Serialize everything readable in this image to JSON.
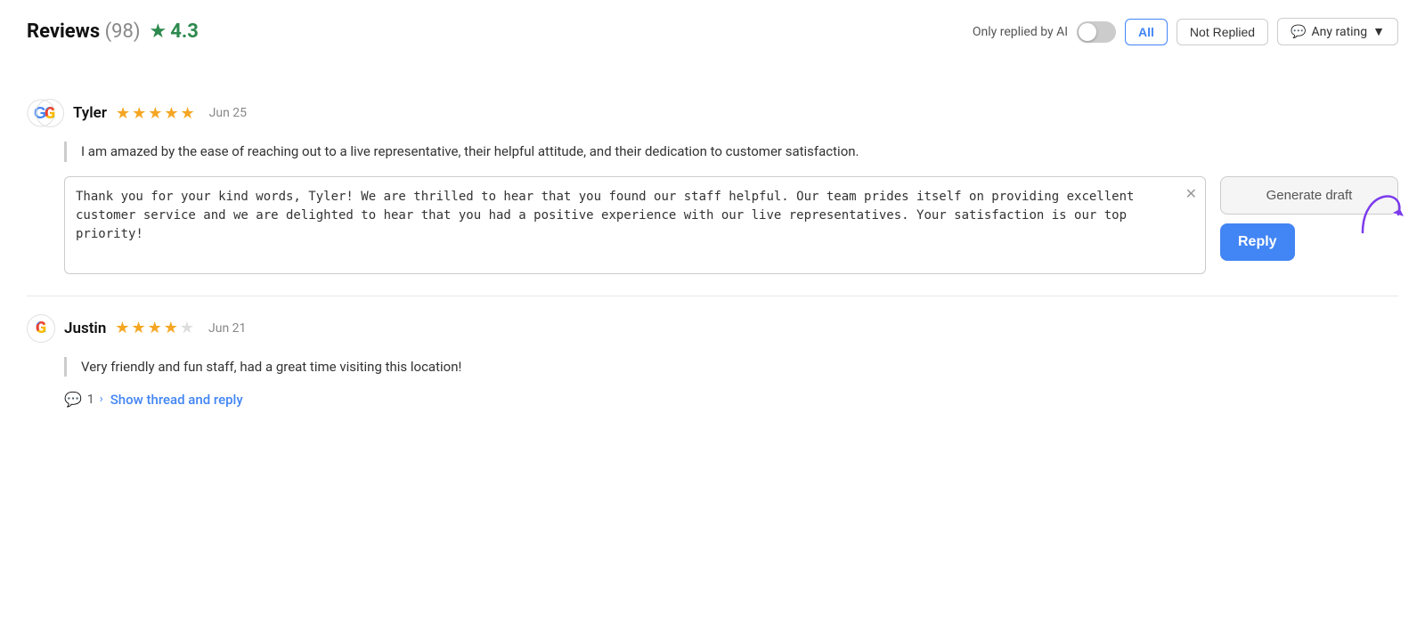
{
  "header": {
    "title": "Reviews",
    "count": "(98)",
    "rating": "4.3",
    "toggle_label": "Only replied by AI",
    "filter_all": "All",
    "filter_not_replied": "Not Replied",
    "rating_dropdown": "Any rating",
    "rating_dropdown_icon": "▼"
  },
  "reviews": [
    {
      "id": "review-tyler",
      "reviewer": "Tyler",
      "stars": 5,
      "date": "Jun 25",
      "review_text": "I am amazed by the ease of reaching out to a live representative, their helpful attitude, and their dedication to customer satisfaction.",
      "reply_text": "Thank you for your kind words, Tyler! We are thrilled to hear that you found our staff helpful. Our team prides itself on providing excellent customer service and we are delighted to hear that you had a positive experience with our live representatives. Your satisfaction is our top priority!",
      "generate_draft_label": "Generate draft",
      "reply_label": "Reply"
    },
    {
      "id": "review-justin",
      "reviewer": "Justin",
      "stars": 4,
      "date": "Jun 21",
      "review_text": "Very friendly and fun staff, had a great time visiting this location!",
      "thread_count": "1",
      "show_thread_label": "Show thread and reply"
    }
  ]
}
